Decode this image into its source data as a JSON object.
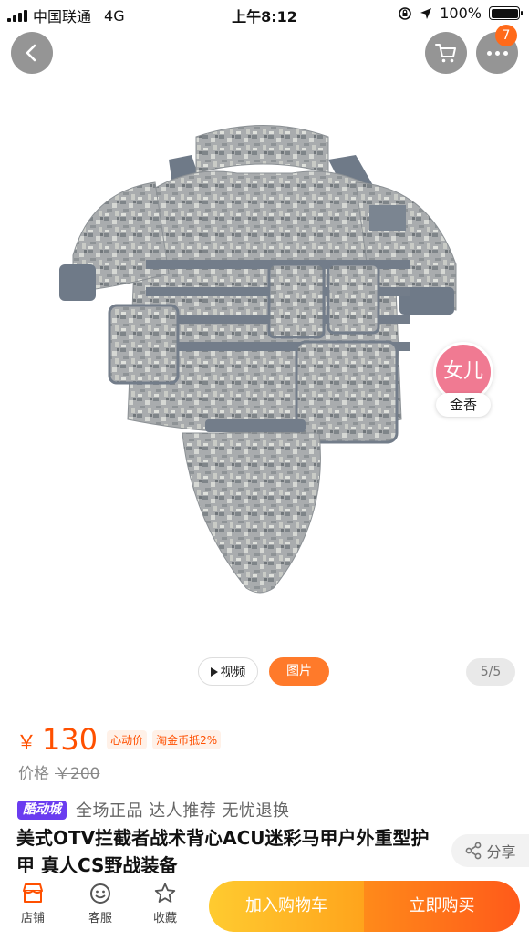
{
  "status_bar": {
    "carrier": "中国联通",
    "network": "4G",
    "time": "上午8:12",
    "battery": "100%"
  },
  "header": {
    "cart_badge": "7"
  },
  "float_avatar": {
    "avatar_text": "女儿",
    "label": "金香"
  },
  "media": {
    "video_label": "视频",
    "image_label": "图片",
    "page_indicator": "5/5"
  },
  "price": {
    "currency": "￥",
    "value": "130",
    "tag1": "心动价",
    "tag2": "淘金币抵2%",
    "original_label": "价格",
    "original_value": "￥200"
  },
  "tags": {
    "brand": "酷动城",
    "text": "全场正品 达人推荐 无忧退换"
  },
  "title": "美式OTV拦截者战术背心ACU迷彩马甲户外重型护甲 真人CS野战装备",
  "share_label": "分享",
  "bottom_bar": {
    "shop_label": "店铺",
    "service_label": "客服",
    "fav_label": "收藏",
    "cart_button": "加入购物车",
    "buy_button": "立即购买"
  },
  "colors": {
    "accent": "#ff5000",
    "cart_button": "#ffb020",
    "buy_button": "#ff6a1a",
    "brand_badge": "#6a3cf0",
    "avatar": "#f07a92"
  }
}
